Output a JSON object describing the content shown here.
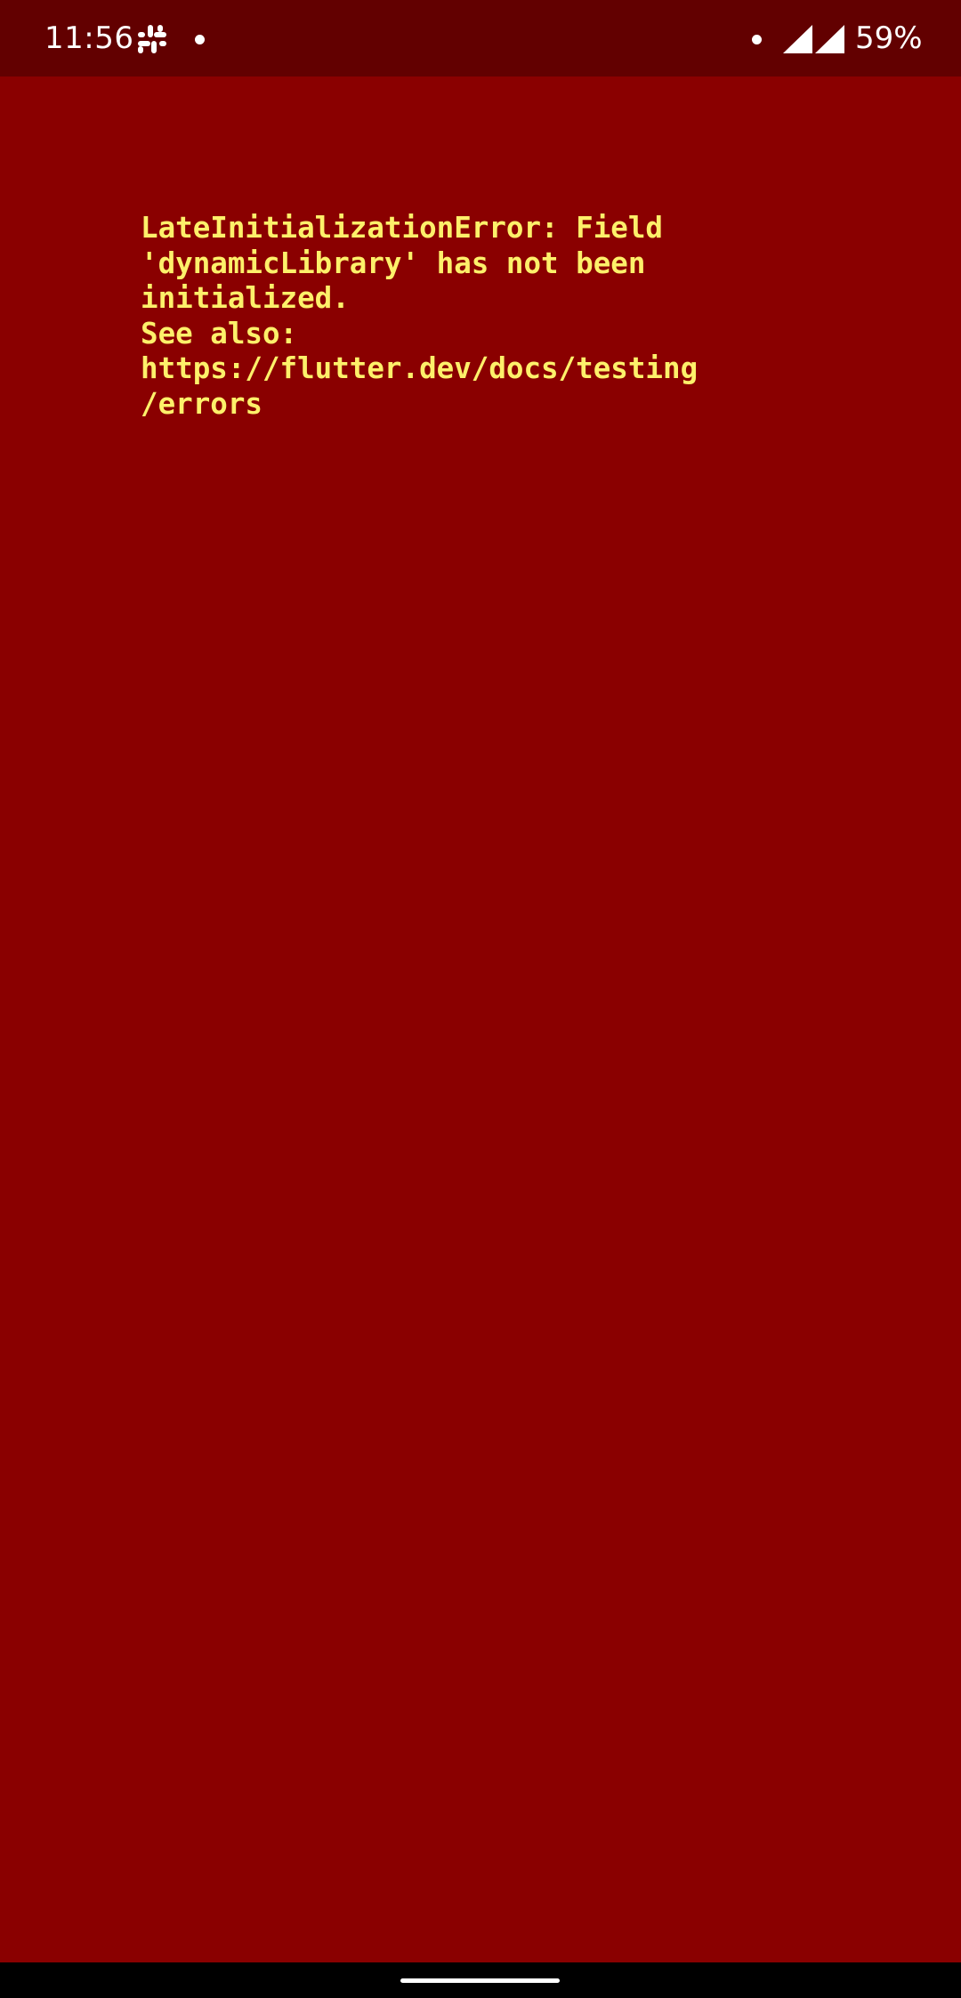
{
  "status_bar": {
    "time": "11:56",
    "battery": "59%",
    "icons": [
      "slack-icon",
      "notification-dot-icon",
      "signal-icon",
      "signal-icon"
    ]
  },
  "error": {
    "lines": [
      "LateInitializationError: Field",
      "'dynamicLibrary' has not been",
      "initialized.",
      "See also:",
      "https://flutter.dev/docs/testing",
      "/errors"
    ]
  },
  "colors": {
    "background": "#8a0000",
    "status_bar": "#620000",
    "error_text": "#fdf06a",
    "nav_bar": "#000000"
  }
}
